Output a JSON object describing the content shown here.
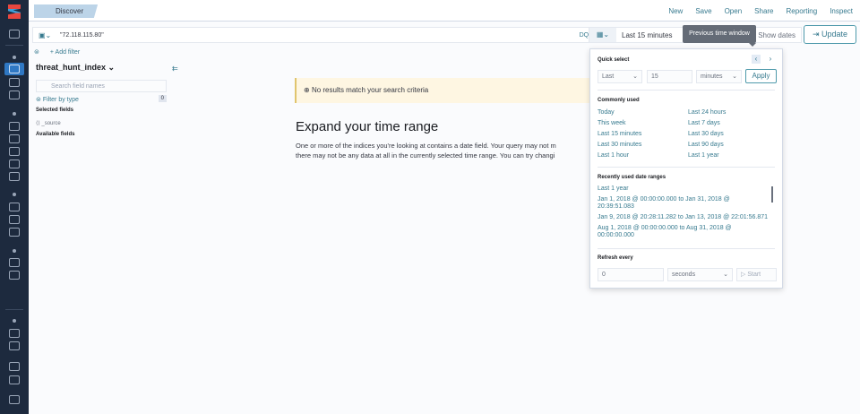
{
  "app": {
    "breadcrumb": "Discover"
  },
  "menu": [
    "New",
    "Save",
    "Open",
    "Share",
    "Reporting",
    "Inspect"
  ],
  "query": {
    "value": "\"72.118.115.80\"",
    "language": "DQL"
  },
  "datepicker": {
    "value": "Last 15 minutes",
    "show_dates": "Show dates",
    "update": "Update",
    "tooltip": "Previous time window"
  },
  "filter": {
    "add": "+ Add filter"
  },
  "sidebar": {
    "index": "threat_hunt_index",
    "search_placeholder": "Search field names",
    "filter_by_type": "Filter by type",
    "filter_count": "0",
    "selected_fields": "Selected fields",
    "source": "_source",
    "available_fields": "Available fields"
  },
  "main": {
    "callout": "No results match your search criteria",
    "title": "Expand your time range",
    "para1": "One or more of the indices you're looking at contains a date field. Your query may not m",
    "para2": "there may not be any data at all in the currently selected time range. You can try changi"
  },
  "popover": {
    "quick_select": "Quick select",
    "tense": "Last",
    "amount": "15",
    "unit": "minutes",
    "apply": "Apply",
    "commonly_used": "Commonly used",
    "common": [
      "Today",
      "Last 24 hours",
      "This week",
      "Last 7 days",
      "Last 15 minutes",
      "Last 30 days",
      "Last 30 minutes",
      "Last 90 days",
      "Last 1 hour",
      "Last 1 year"
    ],
    "recent_title": "Recently used date ranges",
    "recent": [
      "Last 1 year",
      "Jan 1, 2018 @ 00:00:00.000 to Jan 31, 2018 @ 20:39:51.083",
      "Jan 9, 2018 @ 20:28:11.282 to Jan 13, 2018 @ 22:01:56.871",
      "Aug 1, 2018 @ 00:00:00.000 to Aug 31, 2018 @ 00:00:00.000"
    ],
    "refresh_title": "Refresh every",
    "refresh_value": "0",
    "refresh_unit": "seconds",
    "start": "▷ Start"
  }
}
